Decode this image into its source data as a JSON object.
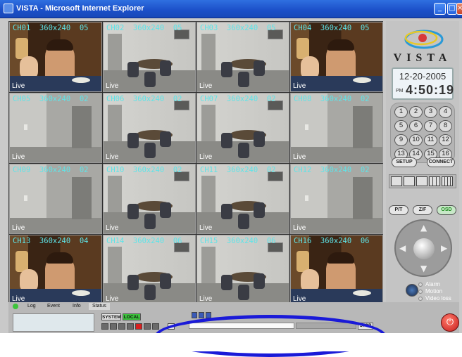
{
  "window": {
    "title": "VISTA - Microsoft Internet Explorer",
    "buttons": {
      "minimize": "_",
      "maximize": "□",
      "close": "×"
    }
  },
  "cameras": [
    {
      "label": "CH01  360x240  05",
      "status": "Live",
      "scene": "cartoon"
    },
    {
      "label": "CH02  360x240  05",
      "status": "Live",
      "scene": "office"
    },
    {
      "label": "CH03  360x240  05",
      "status": "Live",
      "scene": "office"
    },
    {
      "label": "CH04  360x240  05",
      "status": "Live",
      "scene": "cartoon"
    },
    {
      "label": "CH05  360x240  02",
      "status": "Live",
      "scene": "hall"
    },
    {
      "label": "CH06  360x240  02",
      "status": "Live",
      "scene": "office"
    },
    {
      "label": "CH07  360x240  02",
      "status": "Live",
      "scene": "office"
    },
    {
      "label": "CH08  360x240  02",
      "status": "Live",
      "scene": "hall"
    },
    {
      "label": "CH09  360x240  02",
      "status": "Live",
      "scene": "hall"
    },
    {
      "label": "CH10  360x240  02",
      "status": "Live",
      "scene": "office"
    },
    {
      "label": "CH11  360x240  02",
      "status": "Live",
      "scene": "office"
    },
    {
      "label": "CH12  360x240  02",
      "status": "Live",
      "scene": "hall"
    },
    {
      "label": "CH13  360x240  04",
      "status": "Live",
      "scene": "cartoon"
    },
    {
      "label": "CH14  360x240  06",
      "status": "Live",
      "scene": "office"
    },
    {
      "label": "CH15  360x240  06",
      "status": "Live",
      "scene": "office"
    },
    {
      "label": "CH16  360x240  06",
      "status": "Live",
      "scene": "cartoon"
    }
  ],
  "panel": {
    "brand": "VISTA",
    "date": "12-20-2005",
    "ampm": "PM",
    "time": "4:50:19",
    "channel_keys": [
      "1",
      "2",
      "3",
      "4",
      "5",
      "6",
      "7",
      "8",
      "9",
      "10",
      "11",
      "12",
      "13",
      "14",
      "15",
      "16"
    ],
    "setup_label": "SETUP",
    "connect_label": "CONNECT",
    "ptz_labels": {
      "pt": "P/T",
      "zf": "Z/F",
      "osd": "OSD"
    },
    "status_legend": [
      "Alarm",
      "Motion",
      "Video loss"
    ]
  },
  "bottom": {
    "tabs": [
      "Log",
      "Event",
      "Info",
      "Status"
    ],
    "system_label": "SYSTEM",
    "local_label": "LOCAL",
    "stop_label": "STOP",
    "playback_progress": 0.98
  },
  "colors": {
    "title_bar": "#1b4fc8",
    "osd_text": "#5ee4e8",
    "annotation": "#1a1ad8",
    "local_active": "#3cc43c",
    "power": "#d42020"
  }
}
